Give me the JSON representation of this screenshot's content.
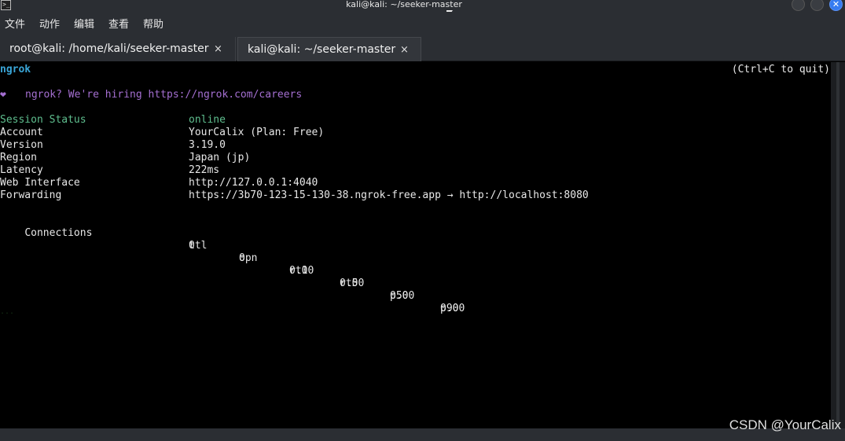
{
  "window": {
    "title": "kali@kali: ~/seeker-master",
    "app_icon": "terminal-icon",
    "close_glyph": "✕"
  },
  "menu": [
    "文件",
    "动作",
    "编辑",
    "查看",
    "帮助"
  ],
  "tabs": [
    {
      "label": "root@kali: /home/kali/seeker-master",
      "close": "×"
    },
    {
      "label": "kali@kali: ~/seeker-master",
      "close": "×"
    }
  ],
  "terminal": {
    "brand": "ngrok",
    "quit_hint": "(Ctrl+C to quit)",
    "heart": "❤",
    "hiring": "ngrok? We're hiring https://ngrok.com/careers",
    "info": [
      {
        "key": "Session Status",
        "value": "online"
      },
      {
        "key": "Account",
        "value": "YourCalix (Plan: Free)"
      },
      {
        "key": "Version",
        "value": "3.19.0"
      },
      {
        "key": "Region",
        "value": "Japan (jp)"
      },
      {
        "key": "Latency",
        "value": "222ms"
      },
      {
        "key": "Web Interface",
        "value": "http://127.0.0.1:4040"
      },
      {
        "key": "Forwarding",
        "value": "https://3b70-123-15-130-38.ngrok-free.app → http://localhost:8080"
      }
    ],
    "connections": {
      "label": "Connections",
      "headers": [
        "ttl",
        "opn",
        "rt1",
        "rt5",
        "p50",
        "p90"
      ],
      "values": [
        "0",
        "0",
        "0.00",
        "0.00",
        "0.00",
        "0.00"
      ]
    },
    "ghost": "..."
  },
  "watermark": "CSDN @YourCalix",
  "colors": {
    "brand": "#3aa6d8",
    "hiring": "#a46fd1",
    "online": "#5fbf8f",
    "close_button": "#367bf0"
  }
}
